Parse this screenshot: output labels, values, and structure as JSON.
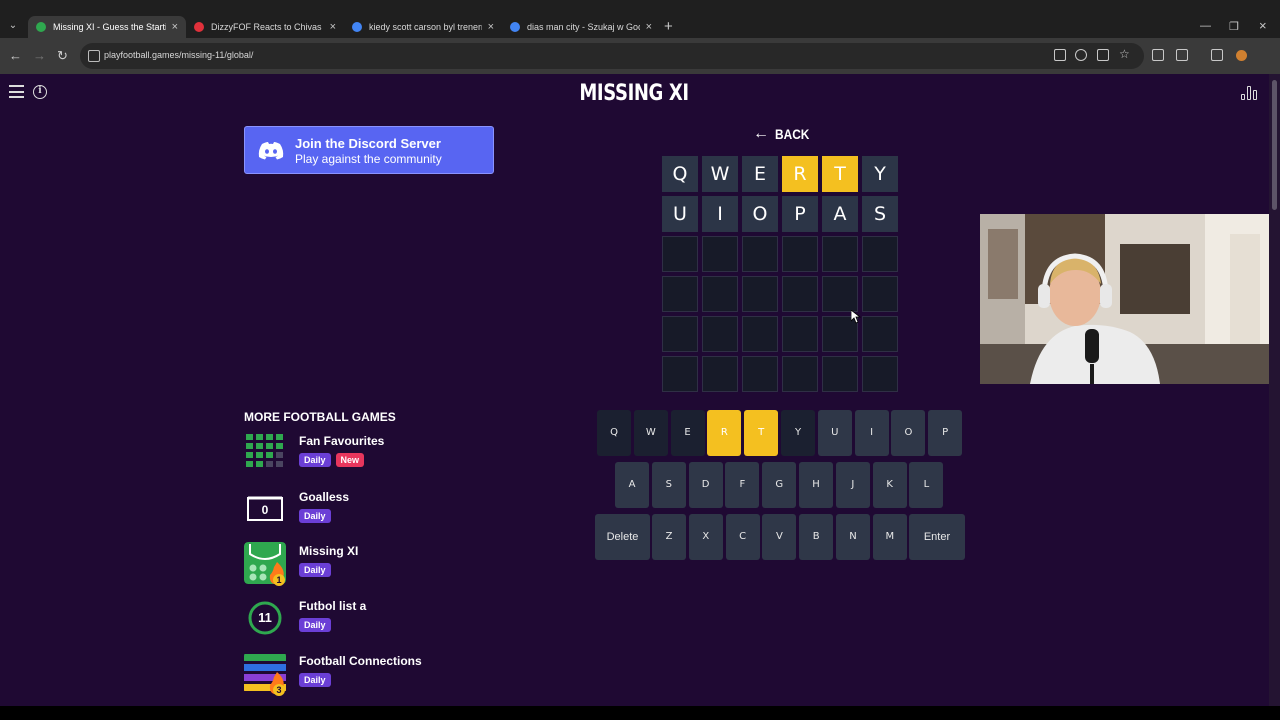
{
  "browser": {
    "tabs": [
      {
        "label": "Missing XI - Guess the Starting",
        "active": true,
        "favicon_color": "#2fa84f"
      },
      {
        "label": "DizzyFOF Reacts to Chivas - De",
        "active": false,
        "favicon_color": "#e0313b"
      },
      {
        "label": "kiedy scott carson byl trenerm",
        "active": false,
        "favicon_color": "#4285f4"
      },
      {
        "label": "dias man city - Szukaj w Google",
        "active": false,
        "favicon_color": "#4285f4"
      }
    ],
    "tab_close": "×",
    "new_tab": "+",
    "url": "playfootball.games/missing-11/global/"
  },
  "header": {
    "title": "MISSING XI"
  },
  "discord": {
    "line1": "Join the Discord Server",
    "line2": "Play against the community"
  },
  "more_games": {
    "title": "MORE FOOTBALL GAMES",
    "items": [
      {
        "name": "Fan Favourites",
        "badges": [
          "Daily",
          "New"
        ]
      },
      {
        "name": "Goalless",
        "badges": [
          "Daily"
        ],
        "icon_text": "0"
      },
      {
        "name": "Missing XI",
        "badges": [
          "Daily"
        ],
        "icon_text": "1"
      },
      {
        "name": "Futbol list a",
        "badges": [
          "Daily"
        ],
        "icon_text": "11"
      },
      {
        "name": "Football Connections",
        "badges": [
          "Daily"
        ],
        "icon_text": "3"
      }
    ]
  },
  "back_label": "BACK",
  "guess_grid": {
    "rows": [
      [
        "Q",
        "W",
        "E",
        "R",
        "T",
        "Y"
      ],
      [
        "U",
        "I",
        "O",
        "P",
        "A",
        "S"
      ],
      [
        "",
        "",
        "",
        "",
        "",
        ""
      ],
      [
        "",
        "",
        "",
        "",
        "",
        ""
      ],
      [
        "",
        "",
        "",
        "",
        "",
        ""
      ],
      [
        "",
        "",
        "",
        "",
        "",
        ""
      ]
    ],
    "yellow": [
      [
        0,
        3
      ],
      [
        0,
        4
      ]
    ]
  },
  "keyboard": {
    "row1": [
      "Q",
      "W",
      "E",
      "R",
      "T",
      "Y",
      "U",
      "I",
      "O",
      "P"
    ],
    "row2": [
      "A",
      "S",
      "D",
      "F",
      "G",
      "H",
      "J",
      "K",
      "L"
    ],
    "row3": [
      "Delete",
      "Z",
      "X",
      "C",
      "V",
      "B",
      "N",
      "M",
      "Enter"
    ],
    "yellow_keys": [
      "R",
      "T"
    ],
    "dark_keys": [
      "Q",
      "W",
      "E",
      "Y"
    ]
  },
  "colors": {
    "page_bg": "#1f0933",
    "yellow": "#f4c020",
    "discord": "#5865f2",
    "badge_daily": "#6b3fd6",
    "badge_new": "#e8365d"
  }
}
